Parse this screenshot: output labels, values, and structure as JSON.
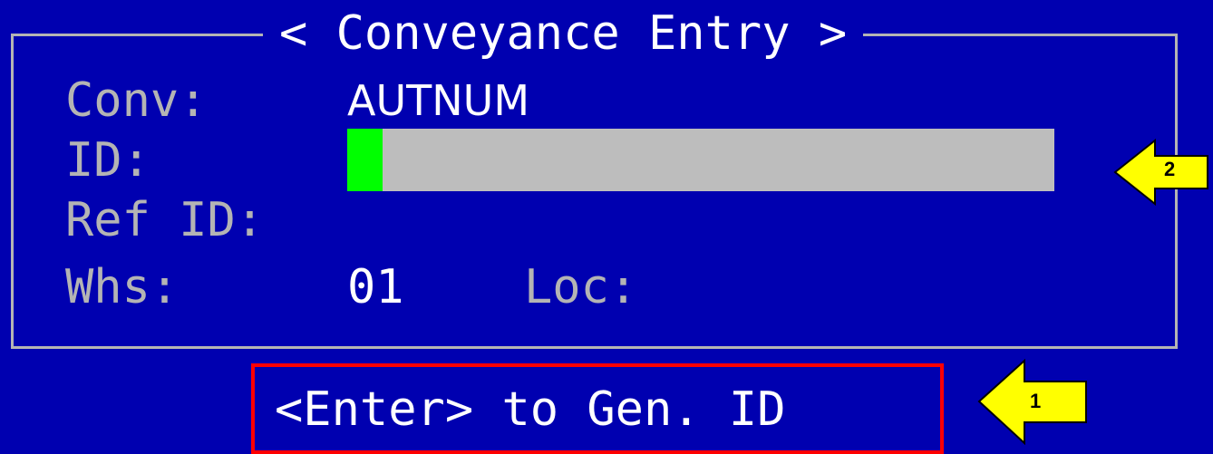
{
  "screen": {
    "title": "< Conveyance Entry >"
  },
  "fields": {
    "conv_label": "Conv:",
    "conv_value": "AUTNUM",
    "id_label": "ID:",
    "id_value": "",
    "ref_id_label": "Ref ID:",
    "whs_label": "Whs:",
    "whs_value": "01",
    "loc_label": "Loc:"
  },
  "prompt": {
    "text": "<Enter> to Gen. ID"
  },
  "callouts": [
    {
      "label": "1",
      "icon": "left-arrow-icon"
    },
    {
      "label": "2",
      "icon": "left-arrow-icon"
    }
  ],
  "colors": {
    "background": "#0000b0",
    "frame": "#b4b4b4",
    "field": "#bdbdbd",
    "cursor": "#00ff00",
    "highlight": "#ff0000",
    "callout": "#ffff00"
  }
}
